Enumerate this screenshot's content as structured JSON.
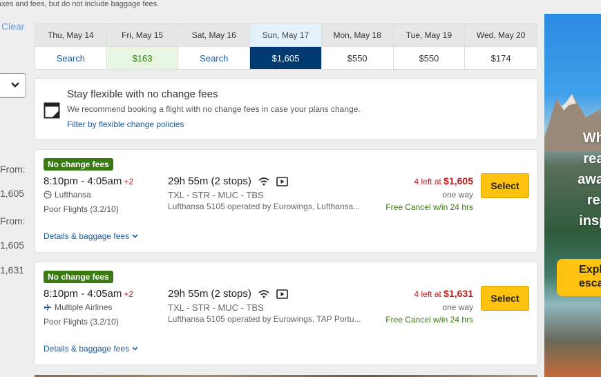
{
  "top_note": "axes and fees, but do not include baggage fees.",
  "left": {
    "clear_label": "Clear",
    "labels": [
      "From:",
      "1,605",
      "From:",
      "1,605",
      "1,631"
    ],
    "blue_fragment": ")"
  },
  "date_strip": [
    {
      "day": "Thu, May 14",
      "price": "Search",
      "kind": "search"
    },
    {
      "day": "Fri, May 15",
      "price": "$163",
      "kind": "cheap"
    },
    {
      "day": "Sat, May 16",
      "price": "Search",
      "kind": "search"
    },
    {
      "day": "Sun, May 17",
      "price": "$1,605",
      "kind": "selected"
    },
    {
      "day": "Mon, May 18",
      "price": "$550",
      "kind": "normal"
    },
    {
      "day": "Tue, May 19",
      "price": "$550",
      "kind": "normal"
    },
    {
      "day": "Wed, May 20",
      "price": "$174",
      "kind": "normal"
    }
  ],
  "flexible": {
    "title": "Stay flexible with no change fees",
    "subtitle": "We recommend booking a flight with no change fees in case your plans change.",
    "link": "Filter by flexible change policies"
  },
  "flights": [
    {
      "badge": "No change fees",
      "times": "8:10pm - 4:05am",
      "day_offset": "+2",
      "airline": "Lufthansa",
      "airline_icon": "globe-icon",
      "rating": "Poor Flights (3.2/10)",
      "details": "Details & baggage fees",
      "duration": "29h 55m (2 stops)",
      "route": "TXL - STR - MUC - TBS",
      "operated": "Lufthansa 5105 operated by Eurowings, Lufthansa...",
      "seats_left": "4 left at",
      "price": "$1,605",
      "trip_type": "one way",
      "cancel": "Free Cancel w/in 24 hrs",
      "select": "Select"
    },
    {
      "badge": "No change fees",
      "times": "8:10pm - 4:05am",
      "day_offset": "+2",
      "airline": "Multiple Airlines",
      "airline_icon": "plane-icon",
      "rating": "Poor Flights (3.2/10)",
      "details": "Details & baggage fees",
      "duration": "29h 55m (2 stops)",
      "route": "TXL - STR - MUC - TBS",
      "operated": "Lufthansa 5105 operated by Eurowings, TAP Portu...",
      "seats_left": "4 left at",
      "price": "$1,631",
      "trip_type": "one way",
      "cancel": "Free Cancel w/in 24 hrs",
      "select": "Select"
    }
  ],
  "ad": {
    "lines": [
      "When",
      "ready",
      "away, v",
      "read",
      "inspire"
    ],
    "button_lines": [
      "Expl",
      "esca"
    ]
  },
  "colors": {
    "selected_date": "#003a70",
    "badge_green": "#3a7a12",
    "price_red": "#c01c1c",
    "select_yellow": "#ffc20e",
    "link_blue": "#1a5a96"
  }
}
